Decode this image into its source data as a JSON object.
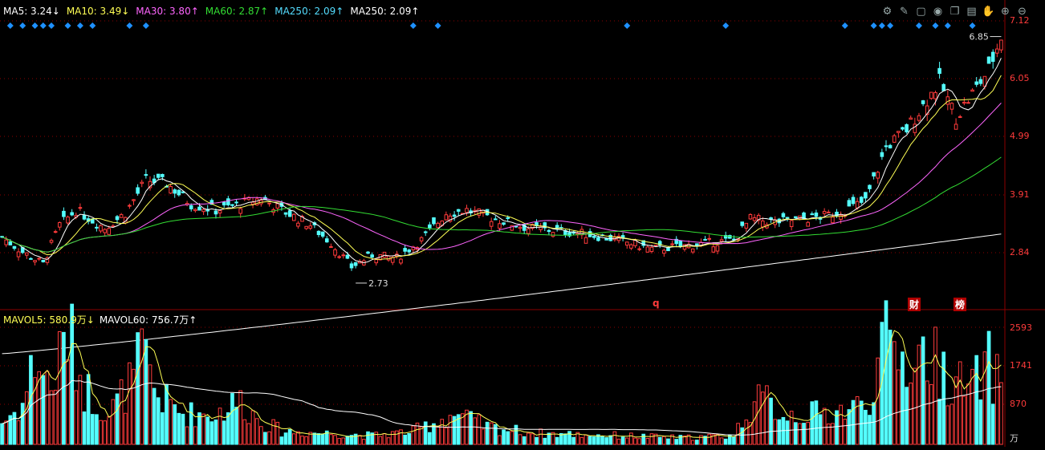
{
  "legend": {
    "ma5": "MA5: 3.24↓",
    "ma10": "MA10: 3.49↓",
    "ma30": "MA30: 3.80↑",
    "ma60": "MA60: 2.87↑",
    "ma250a": "MA250: 2.09↑",
    "ma250b": "MA250: 2.09↑"
  },
  "vol_legend": {
    "mavol5": "MAVOL5: 580.9万↓",
    "mavol60": "MAVOL60: 756.7万↑"
  },
  "annotations": {
    "high_label": "6.85",
    "low_label": "2.73",
    "marker_q": "q",
    "marker_cai": "财",
    "marker_bang": "榜"
  },
  "price_axis": [
    "7.12",
    "6.05",
    "4.99",
    "3.91",
    "2.84"
  ],
  "volume_axis": [
    "2593",
    "1741",
    "870",
    "万"
  ],
  "toolbar_icons": [
    "settings-icon",
    "brush-icon",
    "box-icon",
    "eye-icon",
    "copy-icon",
    "archive-icon",
    "hand-icon",
    "zoom-in-icon",
    "zoom-out-icon"
  ],
  "colors": {
    "up": "#ff3b3b",
    "down": "#54ffff",
    "ma5": "#ffffff",
    "ma10": "#ffff55",
    "ma30": "#ff66ff",
    "ma60": "#33dd33",
    "ma250": "#ffffff",
    "grid": "#8b0000"
  },
  "chart_data": {
    "type": "candlestick",
    "price_range": [
      2.3,
      7.3
    ],
    "volume_range": [
      0,
      2900
    ],
    "close_anchors": [
      [
        0,
        3.5
      ],
      [
        5,
        3.25
      ],
      [
        10,
        3.05
      ],
      [
        14,
        3.7
      ],
      [
        18,
        3.95
      ],
      [
        25,
        3.65
      ],
      [
        30,
        3.9
      ],
      [
        35,
        4.45
      ],
      [
        40,
        4.4
      ],
      [
        46,
        4.05
      ],
      [
        52,
        3.95
      ],
      [
        58,
        4.05
      ],
      [
        63,
        4.15
      ],
      [
        68,
        3.95
      ],
      [
        75,
        3.7
      ],
      [
        80,
        3.4
      ],
      [
        85,
        3.0
      ],
      [
        90,
        3.2
      ],
      [
        96,
        3.15
      ],
      [
        102,
        3.45
      ],
      [
        108,
        3.9
      ],
      [
        113,
        3.95
      ],
      [
        120,
        3.8
      ],
      [
        128,
        3.65
      ],
      [
        136,
        3.6
      ],
      [
        142,
        3.55
      ],
      [
        150,
        3.45
      ],
      [
        158,
        3.3
      ],
      [
        166,
        3.35
      ],
      [
        172,
        3.4
      ],
      [
        178,
        3.45
      ],
      [
        182,
        3.8
      ],
      [
        188,
        3.75
      ],
      [
        195,
        3.8
      ],
      [
        200,
        3.85
      ],
      [
        205,
        3.95
      ],
      [
        210,
        4.1
      ],
      [
        215,
        5.0
      ],
      [
        220,
        5.3
      ],
      [
        225,
        5.8
      ],
      [
        228,
        6.1
      ],
      [
        232,
        5.5
      ],
      [
        236,
        5.9
      ],
      [
        240,
        6.3
      ],
      [
        243,
        6.85
      ]
    ],
    "volume_anchors": [
      [
        0,
        500
      ],
      [
        5,
        900
      ],
      [
        8,
        2000
      ],
      [
        12,
        1300
      ],
      [
        16,
        2600
      ],
      [
        20,
        1300
      ],
      [
        26,
        700
      ],
      [
        32,
        1500
      ],
      [
        34,
        2100
      ],
      [
        38,
        1100
      ],
      [
        44,
        700
      ],
      [
        52,
        700
      ],
      [
        58,
        1000
      ],
      [
        62,
        600
      ],
      [
        68,
        300
      ],
      [
        80,
        250
      ],
      [
        90,
        200
      ],
      [
        100,
        300
      ],
      [
        110,
        700
      ],
      [
        118,
        400
      ],
      [
        130,
        250
      ],
      [
        150,
        200
      ],
      [
        165,
        150
      ],
      [
        178,
        200
      ],
      [
        182,
        900
      ],
      [
        186,
        1000
      ],
      [
        190,
        700
      ],
      [
        200,
        700
      ],
      [
        210,
        900
      ],
      [
        215,
        2300
      ],
      [
        220,
        1900
      ],
      [
        225,
        2100
      ],
      [
        230,
        1600
      ],
      [
        235,
        1200
      ],
      [
        240,
        1800
      ],
      [
        243,
        1400
      ]
    ],
    "ma250_range": [
      1.55,
      3.55
    ],
    "annotations_values": {
      "high": 6.85,
      "low": 2.73
    }
  }
}
